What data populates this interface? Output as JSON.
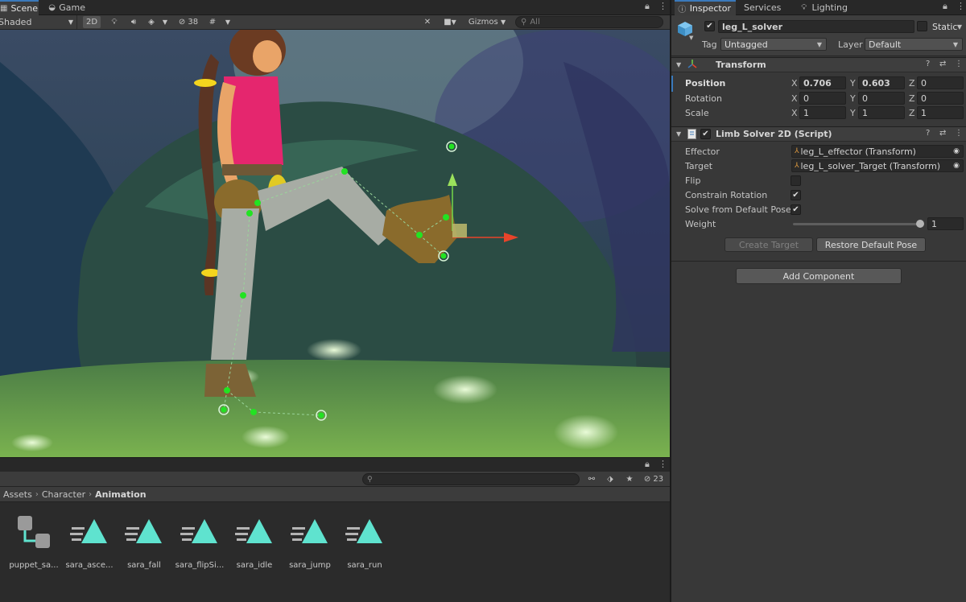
{
  "scene": {
    "tabs": [
      {
        "label": "Scene",
        "icon": "grid-icon",
        "active": true
      },
      {
        "label": "Game",
        "icon": "gamepad-icon",
        "active": false
      }
    ],
    "toolbar": {
      "shading_mode": "Shaded",
      "btn_2d": "2D",
      "hidden_count": "38",
      "gizmos": "Gizmos",
      "search_placeholder": "All"
    }
  },
  "project": {
    "hidden_count": "23",
    "breadcrumb": [
      "Assets",
      "Character",
      "Animation"
    ],
    "assets": [
      {
        "label": "puppet_sa...",
        "icon": "prefab-variant-icon"
      },
      {
        "label": "sara_asce...",
        "icon": "animation-clip-icon"
      },
      {
        "label": "sara_fall",
        "icon": "animation-clip-icon"
      },
      {
        "label": "sara_flipSi...",
        "icon": "animation-clip-icon"
      },
      {
        "label": "sara_idle",
        "icon": "animation-clip-icon"
      },
      {
        "label": "sara_jump",
        "icon": "animation-clip-icon"
      },
      {
        "label": "sara_run",
        "icon": "animation-clip-icon"
      }
    ]
  },
  "inspector": {
    "tabs": [
      {
        "label": "Inspector",
        "icon": "info-icon",
        "active": true
      },
      {
        "label": "Services",
        "active": false
      },
      {
        "label": "Lighting",
        "icon": "bulb-icon",
        "active": false
      }
    ],
    "object": {
      "name": "leg_L_solver",
      "active": true,
      "static_label": "Static",
      "tag_label": "Tag",
      "tag_value": "Untagged",
      "layer_label": "Layer",
      "layer_value": "Default"
    },
    "transform": {
      "title": "Transform",
      "position_label": "Position",
      "rotation_label": "Rotation",
      "scale_label": "Scale",
      "position": {
        "x": "0.706",
        "y": "0.603",
        "z": "0"
      },
      "rotation": {
        "x": "0",
        "y": "0",
        "z": "0"
      },
      "scale": {
        "x": "1",
        "y": "1",
        "z": "1"
      }
    },
    "limb_solver": {
      "title": "Limb Solver 2D (Script)",
      "enabled": true,
      "effector_label": "Effector",
      "effector_value": "leg_L_effector (Transform)",
      "target_label": "Target",
      "target_value": "leg_L_solver_Target (Transform)",
      "flip_label": "Flip",
      "flip": false,
      "constrain_label": "Constrain Rotation",
      "constrain": true,
      "solve_label": "Solve from Default Pose",
      "solve": true,
      "weight_label": "Weight",
      "weight": "1",
      "create_target": "Create Target",
      "restore_pose": "Restore Default Pose"
    },
    "add_component": "Add Component"
  },
  "colors": {
    "accent": "#3a79bb",
    "gizmo_green": "#22e322",
    "gizmo_red": "#e8442a",
    "anim_icon": "#5fe3cf"
  }
}
